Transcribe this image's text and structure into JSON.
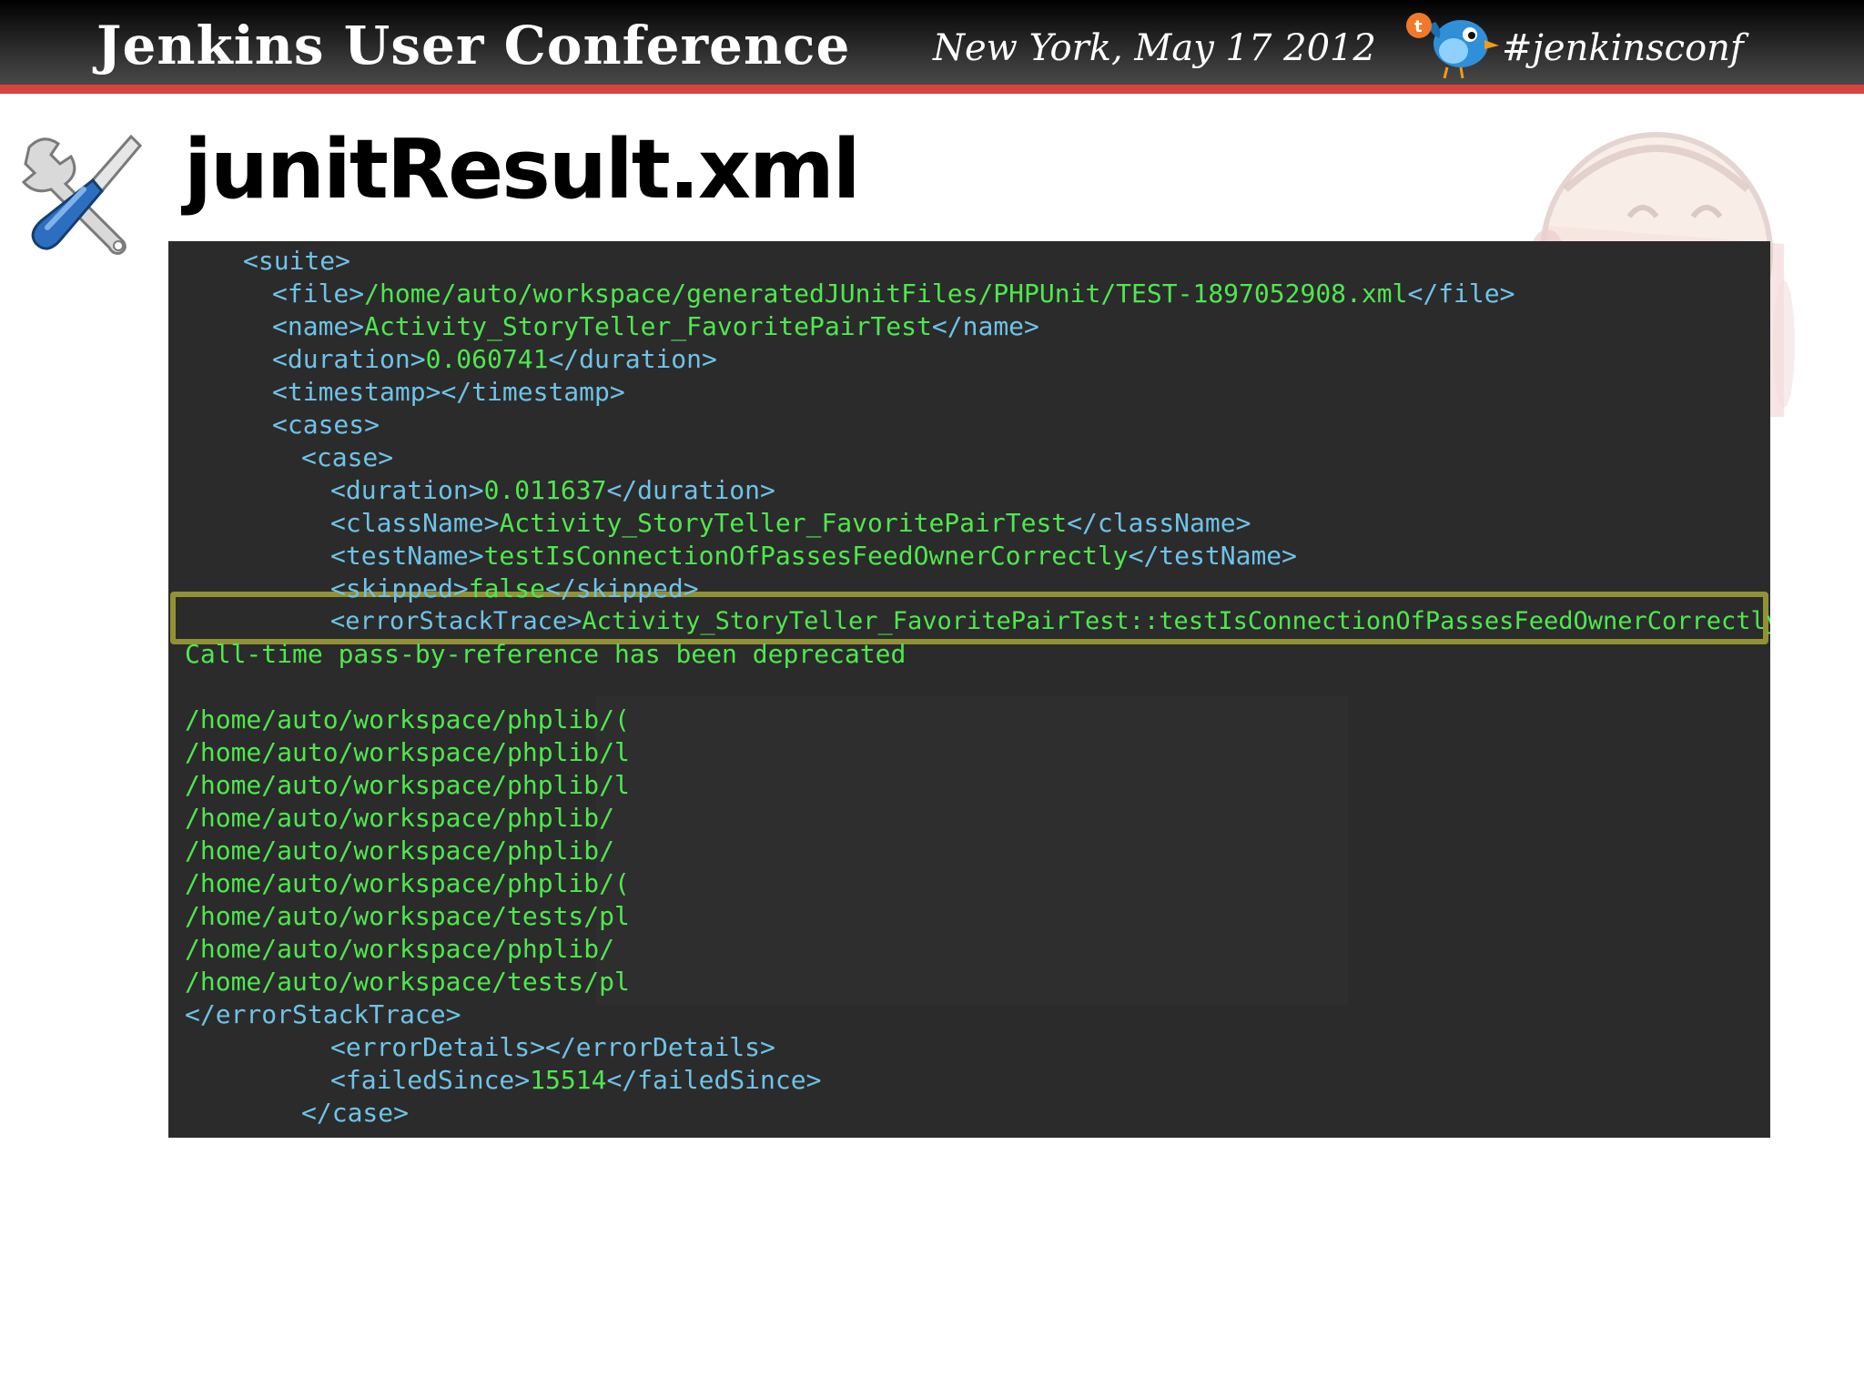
{
  "header": {
    "title": "Jenkins User Conference",
    "place": "New York, May 17  2012",
    "hashtag": "#jenkinsconf"
  },
  "slide": {
    "title": "junitResult.xml"
  },
  "code": {
    "lines": [
      {
        "t1": "<suite>",
        "v1": "",
        "t2": ""
      },
      {
        "t1": "<file>",
        "v1": "/home/auto/workspace/generatedJUnitFiles/PHPUnit/TEST-1897052908.xml",
        "t2": "</file>"
      },
      {
        "t1": "<name>",
        "v1": "Activity_StoryTeller_FavoritePairTest",
        "t2": "</name>"
      },
      {
        "t1": "<duration>",
        "v1": "0.060741",
        "t2": "</duration>"
      },
      {
        "t1": "<timestamp>",
        "v1": "",
        "t2": "</timestamp>"
      },
      {
        "t1": "<cases>",
        "v1": "",
        "t2": ""
      },
      {
        "t1": "<case>",
        "v1": "",
        "t2": ""
      },
      {
        "t1": "<duration>",
        "v1": "0.011637",
        "t2": "</duration>"
      },
      {
        "t1": "<className>",
        "v1": "Activity_StoryTeller_FavoritePairTest",
        "t2": "</className>"
      },
      {
        "t1": "<testName>",
        "v1": "testIsConnectionOfPassesFeedOwnerCorrectly",
        "t2": "</testName>"
      },
      {
        "t1": "<skipped>",
        "v1": "false",
        "t2": "</skipped>"
      },
      {
        "t1": "<errorStackTrace>",
        "v1": "Activity_StoryTeller_FavoritePairTest::testIsConnectionOfPassesFeedOwnerCorrectly",
        "t2": ""
      }
    ],
    "deprecated": "Call-time pass-by-reference has been deprecated",
    "paths": [
      "/home/auto/workspace/phplib/(",
      "/home/auto/workspace/phplib/l",
      "/home/auto/workspace/phplib/l",
      "/home/auto/workspace/phplib/",
      "/home/auto/workspace/phplib/",
      "/home/auto/workspace/phplib/(",
      "/home/auto/workspace/tests/pl",
      "/home/auto/workspace/phplib/",
      "/home/auto/workspace/tests/pl"
    ],
    "close_trace": "</errorStackTrace>",
    "tail": [
      {
        "t1": "<errorDetails>",
        "v1": "",
        "t2": "</errorDetails>"
      },
      {
        "t1": "<failedSince>",
        "v1": "15514",
        "t2": "</failedSince>"
      },
      {
        "t1": "</case>",
        "v1": "",
        "t2": ""
      }
    ]
  },
  "icons": {
    "tools": "wrench-screwdriver-icon",
    "bird": "twitter-bird-icon",
    "mascot": "jenkins-butler-logo"
  },
  "colors": {
    "accent": "#d8433e",
    "tag": "#6fc3e8",
    "value": "#4ee84e",
    "terminal": "#2b2b2b"
  }
}
